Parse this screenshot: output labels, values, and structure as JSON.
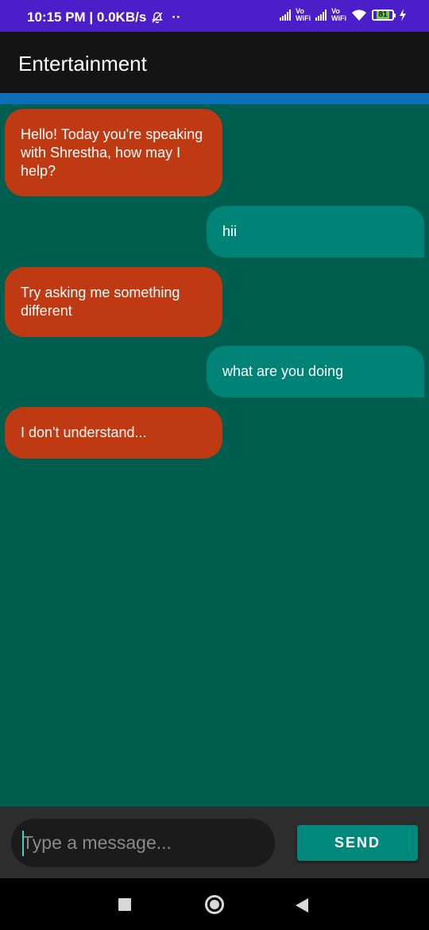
{
  "status_bar": {
    "time_info": "10:15 PM | 0.0KB/s",
    "dots": "··",
    "vowifi_top": "Vo",
    "vowifi_bottom": "WiFi",
    "battery": "81",
    "icons": [
      "mute-bell-icon",
      "signal-icon",
      "vowifi-icon",
      "wifi-icon",
      "battery-icon",
      "charging-bolt-icon"
    ]
  },
  "app_bar": {
    "title": "Entertainment"
  },
  "messages": [
    {
      "sender": "bot",
      "text": "Hello! Today you're speaking with Shrestha, how may I help?"
    },
    {
      "sender": "user",
      "text": "hii"
    },
    {
      "sender": "bot",
      "text": "Try asking me something different"
    },
    {
      "sender": "user",
      "text": "what are you doing"
    },
    {
      "sender": "bot",
      "text": "I don't understand..."
    }
  ],
  "composer": {
    "placeholder": "Type a message...",
    "value": "",
    "send_label": "SEND"
  },
  "nav": {
    "icons": [
      "recents-square-icon",
      "home-circle-icon",
      "back-triangle-icon"
    ]
  },
  "colors": {
    "status_bar": "#4b1ec9",
    "app_bar": "#141414",
    "accent_strip": "#0a6fb8",
    "chat_background": "#005e4f",
    "bot_bubble": "#bf3a12",
    "user_bubble": "#008377",
    "send_button": "#00897b"
  }
}
